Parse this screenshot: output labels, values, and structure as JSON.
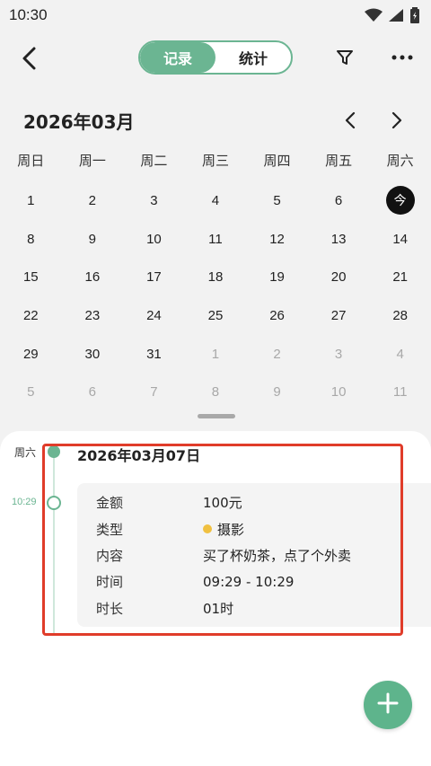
{
  "status_bar": {
    "time": "10:30"
  },
  "header": {
    "tabs": [
      {
        "label": "记录",
        "active": true
      },
      {
        "label": "统计",
        "active": false
      }
    ]
  },
  "calendar": {
    "month_title": "2026年03月",
    "weekdays": [
      "周日",
      "周一",
      "周二",
      "周三",
      "周四",
      "周五",
      "周六"
    ],
    "today_label": "今",
    "weeks": [
      [
        {
          "d": "1"
        },
        {
          "d": "2"
        },
        {
          "d": "3"
        },
        {
          "d": "4"
        },
        {
          "d": "5"
        },
        {
          "d": "6"
        },
        {
          "d": "今",
          "today": true
        }
      ],
      [
        {
          "d": "8"
        },
        {
          "d": "9"
        },
        {
          "d": "10"
        },
        {
          "d": "11"
        },
        {
          "d": "12"
        },
        {
          "d": "13"
        },
        {
          "d": "14"
        }
      ],
      [
        {
          "d": "15"
        },
        {
          "d": "16"
        },
        {
          "d": "17"
        },
        {
          "d": "18"
        },
        {
          "d": "19"
        },
        {
          "d": "20"
        },
        {
          "d": "21"
        }
      ],
      [
        {
          "d": "22"
        },
        {
          "d": "23"
        },
        {
          "d": "24"
        },
        {
          "d": "25"
        },
        {
          "d": "26"
        },
        {
          "d": "27"
        },
        {
          "d": "28"
        }
      ],
      [
        {
          "d": "29"
        },
        {
          "d": "30"
        },
        {
          "d": "31"
        },
        {
          "d": "1",
          "muted": true
        },
        {
          "d": "2",
          "muted": true
        },
        {
          "d": "3",
          "muted": true
        },
        {
          "d": "4",
          "muted": true
        }
      ],
      [
        {
          "d": "5",
          "muted": true
        },
        {
          "d": "6",
          "muted": true
        },
        {
          "d": "7",
          "muted": true
        },
        {
          "d": "8",
          "muted": true
        },
        {
          "d": "9",
          "muted": true
        },
        {
          "d": "10",
          "muted": true
        },
        {
          "d": "11",
          "muted": true
        }
      ]
    ]
  },
  "timeline": {
    "weekday": "周六",
    "date": "2026年03月07日",
    "time": "10:29",
    "record": [
      {
        "label": "金额",
        "value": "100元"
      },
      {
        "label": "类型",
        "value": "摄影",
        "dot": true
      },
      {
        "label": "内容",
        "value": "买了杯奶茶，点了个外卖"
      },
      {
        "label": "时间",
        "value": "09:29 - 10:29"
      },
      {
        "label": "时长",
        "value": "01时"
      }
    ]
  },
  "colors": {
    "accent": "#6bb592",
    "type_dot": "#f0c040",
    "highlight": "#e03c2a",
    "today": "#111111"
  }
}
